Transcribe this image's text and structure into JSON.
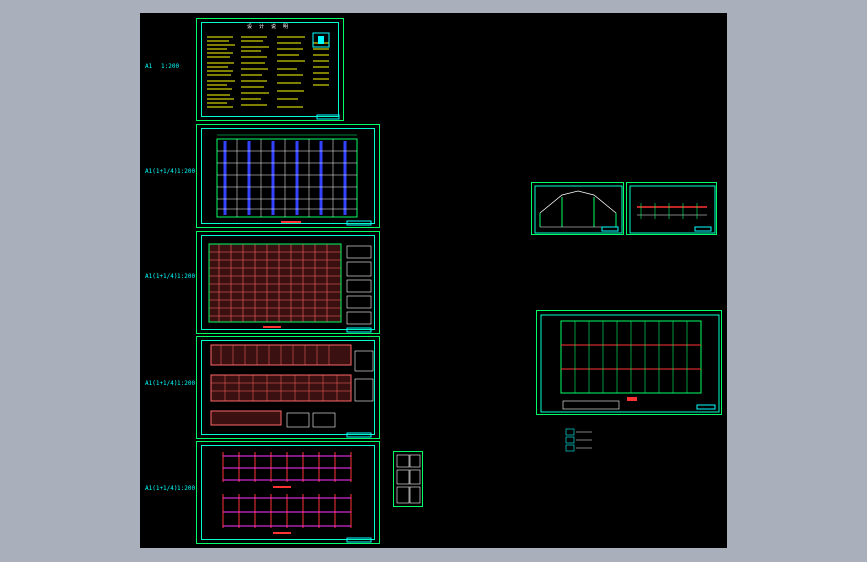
{
  "sheets": [
    {
      "label": "A1",
      "scale": "1:200"
    },
    {
      "label": "A1(1+1/4)",
      "scale": "1:200"
    },
    {
      "label": "A1(1+1/4)",
      "scale": "1:200"
    },
    {
      "label": "A1(1+1/4)",
      "scale": "1:200"
    },
    {
      "label": "A1(1+1/4)",
      "scale": "1:200"
    }
  ],
  "notes_title": "设 计 说 明",
  "colors": {
    "background": "#000000",
    "frame": "#00ff66",
    "cyan": "#00ffff",
    "yellow": "#ffff00",
    "red": "#ff3333",
    "blue": "#3344ff",
    "magenta": "#ff33ff"
  }
}
